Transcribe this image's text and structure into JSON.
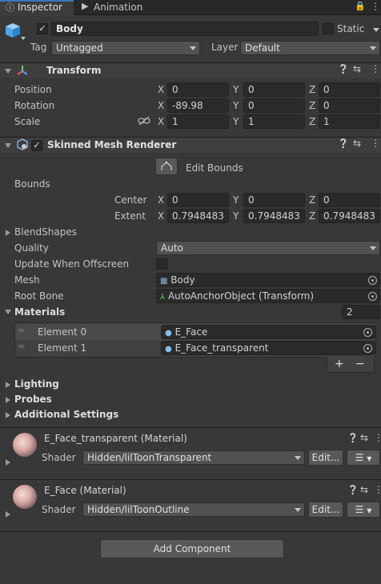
{
  "tabs": [
    {
      "label": "Inspector",
      "icon": "info-icon"
    },
    {
      "label": "Animation",
      "icon": "animation-icon"
    }
  ],
  "object": {
    "name": "Body",
    "static_label": "Static",
    "tag_label": "Tag",
    "tag_value": "Untagged",
    "layer_label": "Layer",
    "layer_value": "Default"
  },
  "transform": {
    "title": "Transform",
    "position": {
      "label": "Position",
      "x": "0",
      "y": "0",
      "z": "0"
    },
    "rotation": {
      "label": "Rotation",
      "x": "-89.98",
      "y": "0",
      "z": "0"
    },
    "scale": {
      "label": "Scale",
      "x": "1",
      "y": "1",
      "z": "1"
    }
  },
  "axes": {
    "x": "X",
    "y": "Y",
    "z": "Z"
  },
  "smr": {
    "title": "Skinned Mesh Renderer",
    "edit_bounds": "Edit Bounds",
    "bounds_label": "Bounds",
    "center": {
      "label": "Center",
      "x": "0",
      "y": "0",
      "z": "0"
    },
    "extent": {
      "label": "Extent",
      "x": "0.7948483",
      "y": "0.7948483",
      "z": "0.7948483"
    },
    "blendshapes": "BlendShapes",
    "quality_label": "Quality",
    "quality_value": "Auto",
    "update_offscreen": "Update When Offscreen",
    "mesh_label": "Mesh",
    "mesh_value": "Body",
    "rootbone_label": "Root Bone",
    "rootbone_value": "AutoAnchorObject (Transform)",
    "materials_label": "Materials",
    "materials_count": "2",
    "elements": [
      {
        "label": "Element 0",
        "value": "E_Face"
      },
      {
        "label": "Element 1",
        "value": "E_Face_transparent"
      }
    ],
    "plus": "+",
    "minus": "−",
    "lighting": "Lighting",
    "probes": "Probes",
    "additional": "Additional Settings"
  },
  "materials": [
    {
      "title": "E_Face_transparent (Material)",
      "shader_label": "Shader",
      "shader_value": "Hidden/lilToonTransparent",
      "edit_label": "Edit..."
    },
    {
      "title": "E_Face (Material)",
      "shader_label": "Shader",
      "shader_value": "Hidden/lilToonOutline",
      "edit_label": "Edit..."
    }
  ],
  "add_component": "Add Component"
}
